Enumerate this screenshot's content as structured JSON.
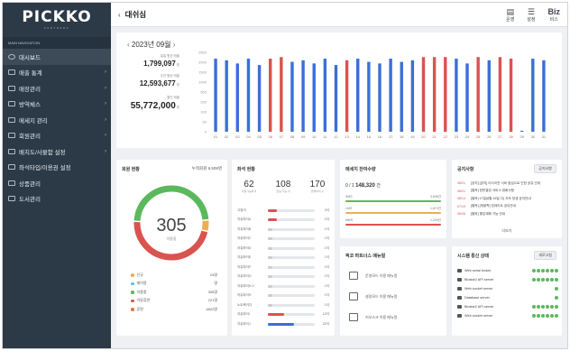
{
  "brand": {
    "name": "PICKKO",
    "sub": "PARTNERS"
  },
  "sidebar": {
    "caption": "MAIN NAVIGATION",
    "items": [
      {
        "label": "대시보드",
        "icon": "dashboard-icon",
        "chevron": false,
        "active": true
      },
      {
        "label": "매출 통계",
        "icon": "chart-icon",
        "chevron": true
      },
      {
        "label": "매장관리",
        "icon": "store-icon",
        "chevron": true
      },
      {
        "label": "방역체스",
        "icon": "shield-icon",
        "chevron": true
      },
      {
        "label": "메세지 관리",
        "icon": "mail-icon",
        "chevron": true
      },
      {
        "label": "회원관리",
        "icon": "users-icon",
        "chevron": true
      },
      {
        "label": "배치도/사물함 설정",
        "icon": "layout-icon",
        "chevron": true
      },
      {
        "label": "좌석타입/이용권 설정",
        "icon": "ticket-icon",
        "chevron": false
      },
      {
        "label": "상품관리",
        "icon": "product-icon",
        "chevron": false
      },
      {
        "label": "도서관리",
        "icon": "book-icon",
        "chevron": false
      }
    ]
  },
  "header": {
    "title": "대쉬심",
    "actions": [
      {
        "label": "운영",
        "icon": "book-open-icon"
      },
      {
        "label": "설정",
        "icon": "sliders-icon"
      },
      {
        "label": "비스",
        "icon": "biz-icon",
        "text": "Biz"
      }
    ]
  },
  "revenue": {
    "month": "2023년 09월",
    "kpis": [
      {
        "label": "일일 평균 매출",
        "value": "1,799,097",
        "unit": "원"
      },
      {
        "label": "주간 평균 매출",
        "value": "12,593,677",
        "unit": "원"
      },
      {
        "label": "월간 매출",
        "value": "55,772,000",
        "unit": "원"
      }
    ]
  },
  "chart_data": {
    "type": "bar",
    "categories": [
      "01",
      "02",
      "03",
      "04",
      "05",
      "06",
      "07",
      "08",
      "09",
      "10",
      "11",
      "12",
      "13",
      "14",
      "15",
      "16",
      "17",
      "18",
      "19",
      "20",
      "21",
      "22",
      "23",
      "24",
      "25",
      "26",
      "27",
      "28",
      "29",
      "30",
      "31"
    ],
    "values": [
      2300,
      2250,
      2150,
      2300,
      2100,
      2300,
      2350,
      2200,
      2250,
      2150,
      2300,
      2100,
      2250,
      2300,
      2200,
      2150,
      2300,
      2200,
      2250,
      2350,
      2350,
      2350,
      2300,
      2150,
      2350,
      2250,
      2350,
      2300,
      30,
      2300,
      2250
    ],
    "colors": [
      "#3a6fd8",
      "#3a6fd8",
      "#3a6fd8",
      "#3a6fd8",
      "#3a6fd8",
      "#d9534f",
      "#d9534f",
      "#3a6fd8",
      "#3a6fd8",
      "#3a6fd8",
      "#3a6fd8",
      "#3a6fd8",
      "#d9534f",
      "#3a6fd8",
      "#3a6fd8",
      "#3a6fd8",
      "#3a6fd8",
      "#3a6fd8",
      "#3a6fd8",
      "#d9534f",
      "#d9534f",
      "#d9534f",
      "#3a6fd8",
      "#3a6fd8",
      "#d9534f",
      "#3a6fd8",
      "#d9534f",
      "#d9534f",
      "#3a6fd8",
      "#3a6fd8",
      "#3a6fd8"
    ],
    "yticks": [
      "2500",
      "2000",
      "1500",
      "1000",
      "500",
      "250",
      "100",
      "50",
      "0"
    ],
    "ylim": [
      0,
      2500
    ],
    "title": "",
    "xlabel": "",
    "ylabel": ""
  },
  "members": {
    "title": "회원 현황",
    "total_label": "누적회원 6,509명",
    "center_value": "305",
    "center_label": "이용중",
    "legend": [
      {
        "label": "신규",
        "value": "24명",
        "color": "#f0ad4e"
      },
      {
        "label": "재이용",
        "value": "명",
        "color": "#5bc0de"
      },
      {
        "label": "이용중",
        "value": "305명",
        "color": "#5cb85c"
      },
      {
        "label": "이달휴면",
        "value": "221명",
        "color": "#d9534f"
      },
      {
        "label": "휴면",
        "value": "4822명",
        "color": "#e07a3a"
      }
    ],
    "ring_fractions": {
      "green": 0.48,
      "red": 0.47,
      "orange": 0.05
    }
  },
  "seats": {
    "title": "좌석 현황",
    "stats": [
      {
        "value": "62",
        "label": "사용가능좌석"
      },
      {
        "value": "108",
        "label": "입실 가능 석"
      },
      {
        "value": "170",
        "label": "전체좌석 수"
      }
    ],
    "rows": [
      {
        "name": "고정석",
        "count": "3석",
        "fill": 0.2,
        "color": "#d9534f"
      },
      {
        "name": "자유좌석A",
        "count": "1석",
        "fill": 0.2,
        "color": "#d9534f"
      },
      {
        "name": "자유좌석B",
        "count": "1석",
        "fill": 0.1,
        "color": "#cccccc"
      },
      {
        "name": "자유좌석C",
        "count": "1석",
        "fill": 0.1,
        "color": "#cccccc"
      },
      {
        "name": "자유좌석D",
        "count": "1석",
        "fill": 0.1,
        "color": "#cccccc"
      },
      {
        "name": "자유좌석E",
        "count": "1석",
        "fill": 0.1,
        "color": "#cccccc"
      },
      {
        "name": "자유좌석F",
        "count": "1석",
        "fill": 0.1,
        "color": "#cccccc"
      },
      {
        "name": "자유좌석G",
        "count": "1석",
        "fill": 0.1,
        "color": "#cccccc"
      },
      {
        "name": "자유좌석H-2",
        "count": "1석",
        "fill": 0.1,
        "color": "#cccccc"
      },
      {
        "name": "자유좌석H",
        "count": "1석",
        "fill": 0.1,
        "color": "#cccccc"
      },
      {
        "name": "노트북이다",
        "count": "1석",
        "fill": 0.1,
        "color": "#cccccc"
      },
      {
        "name": "자유좌석I",
        "count": "12석",
        "fill": 0.35,
        "color": "#d9534f"
      },
      {
        "name": "자유좌석J",
        "count": "22석",
        "fill": 0.55,
        "color": "#3a6fd8"
      }
    ]
  },
  "messages": {
    "title": "메세지 잔여수량",
    "remaining_prefix": "0 / 1",
    "remaining_value": "148,320",
    "remaining_suffix": "건",
    "rows": [
      {
        "label": "SMS",
        "value": "3,606건",
        "color": "#5cb85c"
      },
      {
        "label": "LMS",
        "value": "1,872건",
        "color": "#f0ad4e"
      },
      {
        "label": "MMS",
        "value": "1,234건",
        "color": "#d9534f"
      }
    ]
  },
  "notice": {
    "title": "공지사항",
    "button": "공지사항",
    "items": [
      {
        "date": "08/21",
        "text": "[공지] [공지] 이사이전 서비 점검으로 인한 공유 안내"
      },
      {
        "date": "08/21",
        "text": "[필독] 한번결성 서비스 정회사항"
      },
      {
        "date": "08/14",
        "text": "[필독] 17일(8월 19일 디) 지속 방생 공지안내"
      },
      {
        "date": "07/19",
        "text": "[필독] [재발학] 업데이트 공유안내"
      },
      {
        "date": "06/28",
        "text": "[필독] 좋답재확 기능 안내"
      }
    ],
    "more": "더보기"
  },
  "partner": {
    "title": "픽코 파트너스 매뉴얼",
    "items": [
      {
        "label": "운영모드 이용 매뉴얼",
        "icon": "book-open-icon"
      },
      {
        "label": "설정모드 이용 매뉴얼",
        "icon": "sliders-icon"
      },
      {
        "label": "키오스크 이용 매뉴얼",
        "icon": "kiosk-icon"
      }
    ]
  },
  "system": {
    "title": "시스템 통신 상태",
    "button": "새로고침",
    "items": [
      {
        "label": "Web serial broker",
        "status_count": 6
      },
      {
        "label": "Biostar2 API server",
        "status_count": 6
      },
      {
        "label": "Web socket server",
        "status_count": 1
      },
      {
        "label": "Database server",
        "status_count": 1
      },
      {
        "label": "Biostar2 API server",
        "status_count": 6
      },
      {
        "label": "Web socket server",
        "status_count": 6
      }
    ]
  }
}
